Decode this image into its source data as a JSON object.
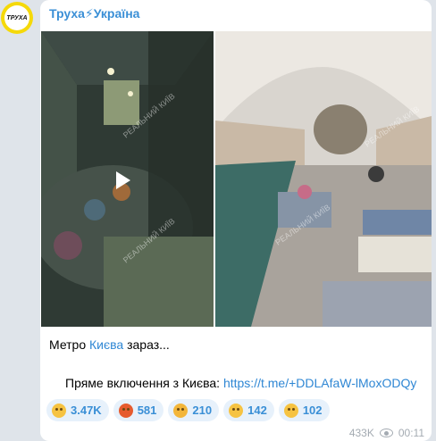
{
  "channel": {
    "name": "Труха⚡Україна",
    "avatar_text": "ТРУХА"
  },
  "media": {
    "left_video_watermark": "РЕАЛЬНИЙ КИЇВ",
    "right_photo_watermark": "РЕАЛЬНИЙ КИЇВ"
  },
  "caption": {
    "line1_prefix": "Метро ",
    "line1_link": "Києва",
    "line1_suffix": " зараз...",
    "line2_label": "Пряме включення з Києва: ",
    "line2_link": "https://t.me/+DDLAfaW-lMoxODQy"
  },
  "reactions": [
    {
      "icon": "crying-face-icon",
      "count": "3.47K"
    },
    {
      "icon": "angry-face-icon",
      "count": "581"
    },
    {
      "icon": "screaming-face-icon",
      "count": "210"
    },
    {
      "icon": "exploding-head-icon",
      "count": "142"
    },
    {
      "icon": "concerned-face-icon",
      "count": "102"
    }
  ],
  "meta": {
    "views": "433K",
    "time": "00:11"
  }
}
